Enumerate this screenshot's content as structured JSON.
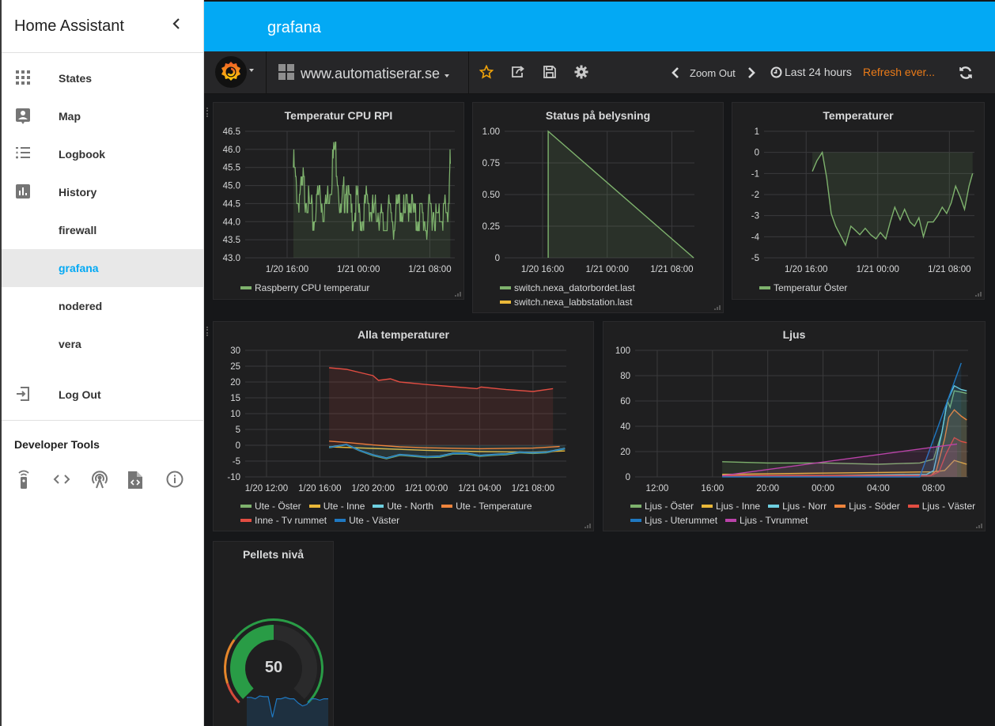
{
  "sidebar": {
    "title": "Home Assistant",
    "collapse_icon": "chevron-left-icon",
    "items": [
      {
        "label": "States",
        "icon": "apps-grid-icon"
      },
      {
        "label": "Map",
        "icon": "account-location-icon"
      },
      {
        "label": "Logbook",
        "icon": "format-list-icon"
      },
      {
        "label": "History",
        "icon": "poll-box-icon"
      },
      {
        "label": "firewall",
        "icon": ""
      },
      {
        "label": "grafana",
        "icon": "",
        "active": true
      },
      {
        "label": "nodered",
        "icon": ""
      },
      {
        "label": "vera",
        "icon": ""
      }
    ],
    "logout": {
      "label": "Log Out",
      "icon": "exit-to-app-icon"
    },
    "developer_tools": {
      "label": "Developer Tools",
      "icons": [
        "remote-icon",
        "code-tags-icon",
        "access-point-icon",
        "file-xml-icon",
        "information-outline-icon"
      ]
    }
  },
  "topbar": {
    "title": "grafana"
  },
  "grafana_nav": {
    "dashboard_name": "www.automatiserar.se",
    "zoom_out": "Zoom Out",
    "time_range": "Last 24 hours",
    "refresh": "Refresh ever...",
    "colors": {
      "accent": "#eb7b18",
      "star": "#f0a30a"
    }
  },
  "panels": {
    "cpu": {
      "title": "Temperatur CPU RPI"
    },
    "status": {
      "title": "Status på belysning"
    },
    "temps": {
      "title": "Temperaturer"
    },
    "alla": {
      "title": "Alla temperaturer"
    },
    "ljus": {
      "title": "Ljus"
    },
    "pellets": {
      "title": "Pellets nivå",
      "value": "50"
    }
  },
  "chart_data": [
    {
      "id": "cpu",
      "type": "line",
      "title": "Temperatur CPU RPI",
      "ylim": [
        43.0,
        46.5
      ],
      "yticks": [
        "46.5",
        "46.0",
        "45.5",
        "45.0",
        "44.5",
        "44.0",
        "43.5",
        "43.0"
      ],
      "xticks": [
        "1/20 16:00",
        "1/21 00:00",
        "1/21 08:00"
      ],
      "x_hours_range": [
        11.3,
        34.8
      ],
      "xtick_hours": [
        16,
        24,
        32
      ],
      "series": [
        {
          "name": "Raspberry CPU temperatur",
          "color": "#7eb26d",
          "fill": true,
          "x_hours": [
            16.7,
            17.2,
            17.8,
            18.4,
            19.0,
            19.6,
            20.2,
            20.8,
            21.4,
            22.0,
            22.6,
            23.2,
            23.8,
            24.4,
            25.0,
            25.6,
            26.2,
            26.8,
            27.4,
            28.0,
            28.6,
            29.2,
            29.8,
            30.4,
            31.0,
            31.6,
            32.2,
            32.8,
            33.4,
            34.0,
            34.3
          ],
          "values": [
            45.6,
            44.6,
            45.0,
            44.5,
            44.0,
            44.9,
            44.3,
            45.0,
            46.2,
            44.2,
            45.0,
            44.1,
            44.5,
            44.0,
            44.6,
            44.2,
            44.4,
            43.8,
            44.3,
            44.0,
            44.5,
            44.1,
            44.7,
            44.0,
            44.2,
            43.9,
            44.4,
            44.0,
            44.3,
            44.1,
            45.6
          ]
        }
      ]
    },
    {
      "id": "status",
      "type": "line",
      "title": "Status på belysning",
      "ylim": [
        0,
        1
      ],
      "yticks": [
        "1.00",
        "0.75",
        "0.50",
        "0.25",
        "0"
      ],
      "xticks": [
        "1/20 16:00",
        "1/21 00:00",
        "1/21 08:00"
      ],
      "x_hours_range": [
        11.3,
        34.8
      ],
      "xtick_hours": [
        16,
        24,
        32
      ],
      "series": [
        {
          "name": "switch.nexa_datorbordet.last",
          "color": "#7eb26d",
          "fill": true,
          "x_hours": [
            16.7,
            16.7,
            34.7
          ],
          "values": [
            0,
            1,
            0
          ]
        },
        {
          "name": "switch.nexa_labbstation.last",
          "color": "#eab839",
          "fill": false,
          "x_hours": [],
          "values": []
        }
      ]
    },
    {
      "id": "temps",
      "type": "line",
      "title": "Temperaturer",
      "ylim": [
        -5,
        1
      ],
      "yticks": [
        "1",
        "0",
        "-1",
        "-2",
        "-3",
        "-4",
        "-5"
      ],
      "xticks": [
        "1/20 16:00",
        "1/21 00:00",
        "1/21 08:00"
      ],
      "x_hours_range": [
        11.3,
        34.8
      ],
      "xtick_hours": [
        16,
        24,
        32
      ],
      "series": [
        {
          "name": "Temperatur Öster",
          "color": "#7eb26d",
          "fill": true,
          "x_hours": [
            16.7,
            17.2,
            17.8,
            18.3,
            18.8,
            19.3,
            19.8,
            20.4,
            21.0,
            21.5,
            22.0,
            22.6,
            23.2,
            23.8,
            24.3,
            24.9,
            25.4,
            25.9,
            26.5,
            27.0,
            27.6,
            28.1,
            28.6,
            29.1,
            29.6,
            30.2,
            30.7,
            31.2,
            31.7,
            32.2,
            32.7,
            33.2,
            33.7,
            34.2,
            34.6
          ],
          "values": [
            -0.9,
            -0.4,
            0.0,
            -1.2,
            -2.9,
            -3.5,
            -3.9,
            -4.4,
            -3.5,
            -3.7,
            -3.9,
            -3.6,
            -3.9,
            -4.1,
            -3.8,
            -4.1,
            -3.3,
            -2.6,
            -3.2,
            -2.7,
            -3.3,
            -3.5,
            -3.1,
            -4.0,
            -3.3,
            -3.3,
            -3.0,
            -2.6,
            -2.9,
            -2.4,
            -1.6,
            -2.1,
            -2.7,
            -1.6,
            -1.0
          ]
        }
      ]
    },
    {
      "id": "alla",
      "type": "line",
      "title": "Alla temperaturer",
      "ylim": [
        -10,
        30
      ],
      "yticks": [
        "30",
        "25",
        "20",
        "15",
        "10",
        "5",
        "0",
        "-5",
        "-10"
      ],
      "xticks": [
        "1/20 12:00",
        "1/20 16:00",
        "1/20 20:00",
        "1/21 00:00",
        "1/21 04:00",
        "1/21 08:00"
      ],
      "x_hours_range": [
        10.4,
        34.5
      ],
      "xtick_hours": [
        12,
        16,
        20,
        24,
        28,
        32
      ],
      "series": [
        {
          "name": "Ute - Öster",
          "color": "#7eb26d",
          "fill": false,
          "x_hours": [
            16.7,
            18.0,
            19.0,
            20.0,
            21.0,
            22.0,
            23.0,
            24.0,
            25.0,
            26.0,
            27.0,
            28.0,
            29.0,
            30.0,
            31.0,
            32.0,
            33.0,
            34.4
          ],
          "values": [
            -0.8,
            0.1,
            -1.8,
            -3.3,
            -4.3,
            -3.2,
            -3.5,
            -3.9,
            -3.8,
            -2.8,
            -2.8,
            -3.5,
            -3.2,
            -3.0,
            -2.4,
            -2.6,
            -2.4,
            -1.2
          ]
        },
        {
          "name": "Ute - Inne",
          "color": "#eab839",
          "fill": false,
          "x_hours": [
            16.7,
            20.0,
            24.0,
            28.0,
            32.0,
            34.4
          ],
          "values": [
            -0.5,
            -1.0,
            -1.6,
            -2.0,
            -2.2,
            -1.8
          ]
        },
        {
          "name": "Ute - North",
          "color": "#6ed0e0",
          "fill": true,
          "x_hours": [
            16.7,
            18.0,
            19.0,
            20.0,
            21.0,
            22.0,
            23.0,
            24.0,
            25.0,
            26.0,
            27.0,
            28.0,
            29.0,
            30.0,
            31.0,
            32.0,
            33.0,
            34.4
          ],
          "values": [
            -0.6,
            0.3,
            -1.6,
            -3.0,
            -4.0,
            -2.9,
            -3.2,
            -3.6,
            -3.4,
            -2.5,
            -2.5,
            -3.2,
            -2.9,
            -2.7,
            -2.1,
            -2.3,
            -2.1,
            -1.0
          ]
        },
        {
          "name": "Ute - Temperature",
          "color": "#ef843c",
          "fill": false,
          "x_hours": [
            16.7,
            18.0,
            20.0,
            22.0,
            24.0,
            28.0,
            32.0,
            34.0
          ],
          "values": [
            1.3,
            0.9,
            0.1,
            -0.5,
            -0.8,
            -1.1,
            -0.9,
            -0.4
          ]
        },
        {
          "name": "Inne - Tv rummet",
          "color": "#e24d42",
          "fill": true,
          "x_hours": [
            16.7,
            18.0,
            19.0,
            20.0,
            20.4,
            21.3,
            22.0,
            24.0,
            26.0,
            27.8,
            28.1,
            30.0,
            32.0,
            33.5
          ],
          "values": [
            24.5,
            24.0,
            23.0,
            22.0,
            20.5,
            21.0,
            20.0,
            19.2,
            18.5,
            17.9,
            18.4,
            17.6,
            17.0,
            17.9
          ]
        },
        {
          "name": "Ute - Väster",
          "color": "#1f78c1",
          "fill": false,
          "x_hours": [
            16.7,
            18.0,
            19.0,
            20.0,
            21.0,
            22.0,
            23.0,
            24.0,
            25.0,
            26.0,
            27.0,
            28.0,
            29.0,
            30.0,
            31.0,
            32.0,
            33.0,
            34.4
          ],
          "values": [
            -0.7,
            0.2,
            -1.7,
            -3.1,
            -4.1,
            -3.0,
            -3.3,
            -3.7,
            -3.5,
            -2.6,
            -2.6,
            -3.3,
            -3.0,
            -2.8,
            -2.2,
            -2.4,
            -2.2,
            -1.1
          ]
        }
      ]
    },
    {
      "id": "ljus",
      "type": "line",
      "title": "Ljus",
      "ylim": [
        0,
        100
      ],
      "yticks": [
        "100",
        "80",
        "60",
        "40",
        "20",
        "0"
      ],
      "xticks": [
        "12:00",
        "16:00",
        "20:00",
        "00:00",
        "04:00",
        "08:00"
      ],
      "x_hours_range": [
        10.4,
        34.5
      ],
      "xtick_hours": [
        12,
        16,
        20,
        24,
        28,
        32
      ],
      "series": [
        {
          "name": "Ljus - Öster",
          "color": "#7eb26d",
          "fill": true,
          "x_hours": [
            16.7,
            20.0,
            24.0,
            28.0,
            31.0,
            32.0,
            32.6,
            33.0,
            33.2,
            33.5,
            34.0,
            34.4
          ],
          "values": [
            12,
            11,
            11,
            10,
            11,
            14,
            35,
            60,
            55,
            68,
            67,
            66
          ]
        },
        {
          "name": "Ljus - Inne",
          "color": "#eab839",
          "fill": true,
          "x_hours": [
            16.7,
            24.0,
            32.0,
            32.8,
            33.5,
            34.4
          ],
          "values": [
            2,
            3,
            4,
            5,
            13,
            10
          ]
        },
        {
          "name": "Ljus - Norr",
          "color": "#6ed0e0",
          "fill": true,
          "x_hours": [
            16.7,
            24.0,
            31.5,
            32.0,
            32.6,
            33.0,
            33.5,
            34.0,
            34.4
          ],
          "values": [
            1,
            1,
            2,
            5,
            35,
            60,
            72,
            69,
            68
          ]
        },
        {
          "name": "Ljus - Söder",
          "color": "#ef843c",
          "fill": true,
          "x_hours": [
            16.7,
            31.8,
            32.2,
            32.8,
            33.1,
            33.5,
            34.0,
            34.4
          ],
          "values": [
            1,
            1,
            5,
            30,
            47,
            53,
            48,
            45
          ]
        },
        {
          "name": "Ljus - Väster",
          "color": "#e24d42",
          "fill": true,
          "x_hours": [
            16.7,
            31.8,
            32.4,
            32.9,
            33.5,
            34.0,
            34.4
          ],
          "values": [
            1,
            1,
            4,
            18,
            31,
            28,
            27
          ]
        },
        {
          "name": "Ljus - Uterummet",
          "color": "#1f78c1",
          "fill": true,
          "x_hours": [
            16.7,
            31.0,
            34.0
          ],
          "values": [
            0,
            0,
            90
          ]
        },
        {
          "name": "Ljus - Tvrummet",
          "color": "#ba43a9",
          "fill": true,
          "x_hours": [
            16.7,
            33.7
          ],
          "values": [
            1,
            26
          ]
        }
      ]
    },
    {
      "id": "pellets",
      "type": "gauge",
      "title": "Pellets nivå",
      "value": 50,
      "range": [
        0,
        100
      ],
      "thresholds": [
        {
          "to": 10,
          "color": "#d44a3a"
        },
        {
          "to": 30,
          "color": "#e5862b"
        },
        {
          "to": 100,
          "color": "#299c46"
        }
      ],
      "sparkline": [
        88,
        88,
        86,
        90,
        89,
        89,
        60,
        86,
        86,
        88,
        86,
        86,
        80,
        76,
        78,
        86,
        86,
        84,
        86,
        86
      ]
    }
  ]
}
